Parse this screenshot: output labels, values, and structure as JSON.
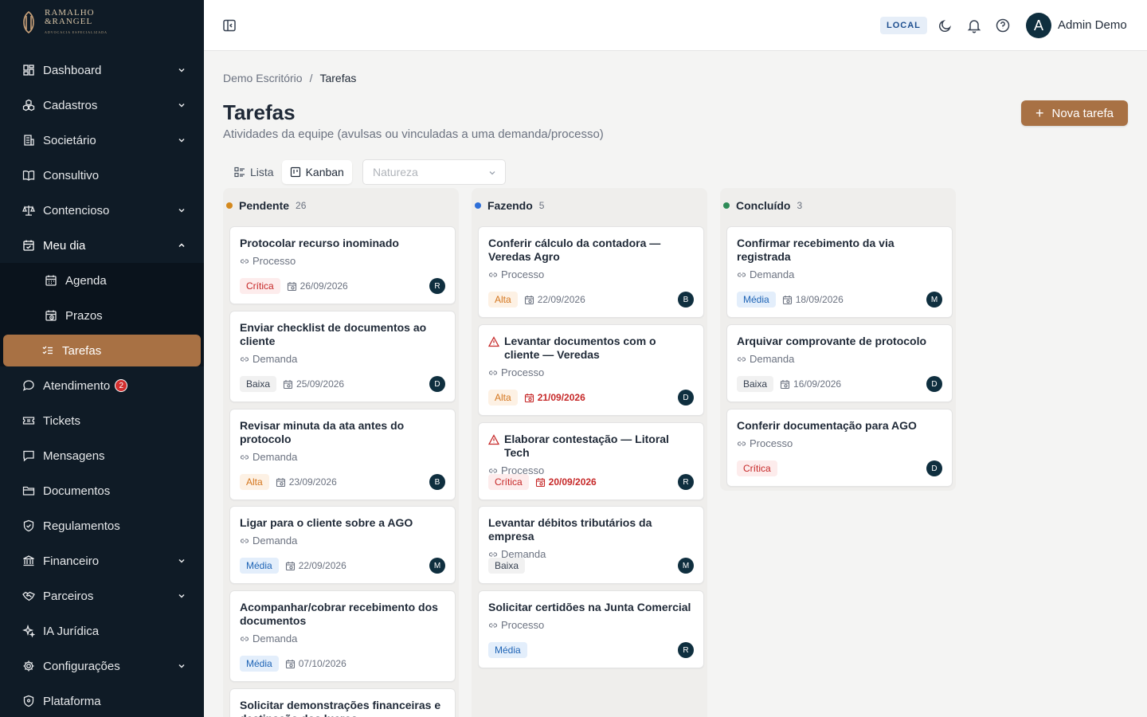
{
  "brand": {
    "line1": "RAMALHO",
    "line2": "&RANGEL",
    "tagline": "ADVOCACIA ESPECIALIZADA"
  },
  "sidebar": {
    "items": [
      {
        "label": "Dashboard",
        "icon": "dashboard-icon",
        "has_chevron": true
      },
      {
        "label": "Cadastros",
        "icon": "cubes-icon",
        "has_chevron": true
      },
      {
        "label": "Societário",
        "icon": "building-icon",
        "has_chevron": true
      },
      {
        "label": "Consultivo",
        "icon": "book-icon",
        "has_chevron": false
      },
      {
        "label": "Contencioso",
        "icon": "scale-icon",
        "has_chevron": true
      },
      {
        "label": "Meu dia",
        "icon": "calendar-check-icon",
        "has_chevron": true,
        "open": true
      },
      {
        "label": "Agenda",
        "icon": "calendar-icon",
        "sub": true
      },
      {
        "label": "Prazos",
        "icon": "calendar-clock-icon",
        "sub": true
      },
      {
        "label": "Tarefas",
        "icon": "checklist-icon",
        "sub": true,
        "active": true
      },
      {
        "label": "Atendimento",
        "icon": "chat-icon",
        "badge": "2"
      },
      {
        "label": "Tickets",
        "icon": "ticket-icon"
      },
      {
        "label": "Mensagens",
        "icon": "message-icon"
      },
      {
        "label": "Documentos",
        "icon": "folder-icon"
      },
      {
        "label": "Regulamentos",
        "icon": "shield-icon"
      },
      {
        "label": "Financeiro",
        "icon": "bank-icon",
        "has_chevron": true
      },
      {
        "label": "Parceiros",
        "icon": "handshake-icon",
        "has_chevron": true
      },
      {
        "label": "IA Jurídica",
        "icon": "sparkles-icon"
      },
      {
        "label": "Configurações",
        "icon": "gear-icon",
        "has_chevron": true
      },
      {
        "label": "Plataforma",
        "icon": "shield-icon"
      }
    ]
  },
  "topbar": {
    "env": "LOCAL",
    "user_initial": "A",
    "user_name": "Admin Demo"
  },
  "breadcrumb": {
    "root": "Demo Escritório",
    "current": "Tarefas"
  },
  "page": {
    "title": "Tarefas",
    "subtitle": "Atividades da equipe (avulsas ou vinculadas a uma demanda/processo)",
    "new_button": "Nova tarefa"
  },
  "view": {
    "list_label": "Lista",
    "kanban_label": "Kanban",
    "filter_placeholder": "Natureza"
  },
  "colors": {
    "accent": "#a87144",
    "sidebar": "#0f1b26",
    "pending": "#d4891e",
    "doing": "#2f6fd8",
    "done": "#2e8b57"
  },
  "columns": [
    {
      "title": "Pendente",
      "count": "26",
      "dot": "#d4891e",
      "cards": [
        {
          "title": "Protocolar recurso inominado",
          "link": "Processo",
          "priority": "Crítica",
          "ptype": "critica",
          "date": "26/09/2026",
          "assignee": "R"
        },
        {
          "title": "Enviar checklist de documentos ao cliente",
          "link": "Demanda",
          "priority": "Baixa",
          "ptype": "baixa",
          "date": "25/09/2026",
          "assignee": "D"
        },
        {
          "title": "Revisar minuta da ata antes do protocolo",
          "link": "Demanda",
          "priority": "Alta",
          "ptype": "alta",
          "date": "23/09/2026",
          "assignee": "B"
        },
        {
          "title": "Ligar para o cliente sobre a AGO",
          "link": "Demanda",
          "priority": "Média",
          "ptype": "media",
          "date": "22/09/2026",
          "assignee": "M"
        },
        {
          "title": "Acompanhar/cobrar recebimento dos documentos",
          "link": "Demanda",
          "priority": "Média",
          "ptype": "media",
          "date": "07/10/2026",
          "assignee": ""
        },
        {
          "title": "Solicitar demonstrações financeiras e destinação dos lucros",
          "link": "",
          "priority": "",
          "ptype": "",
          "date": "",
          "assignee": ""
        }
      ]
    },
    {
      "title": "Fazendo",
      "count": "5",
      "dot": "#2f6fd8",
      "cards": [
        {
          "title": "Conferir cálculo da contadora — Veredas Agro",
          "link": "Processo",
          "priority": "Alta",
          "ptype": "alta",
          "date": "22/09/2026",
          "assignee": "B"
        },
        {
          "title": "Levantar documentos com o cliente — Veredas",
          "link": "Processo",
          "priority": "Alta",
          "ptype": "alta",
          "date": "21/09/2026",
          "assignee": "D",
          "warning": true,
          "overdue": true
        },
        {
          "title": "Elaborar contestação — Litoral Tech",
          "link": "Processo",
          "priority": "Crítica",
          "ptype": "critica",
          "date": "20/09/2026",
          "assignee": "R",
          "warning": true,
          "overdue": true
        },
        {
          "title": "Levantar débitos tributários da empresa",
          "link": "Demanda",
          "priority": "Baixa",
          "ptype": "baixa",
          "date": "",
          "assignee": "M"
        },
        {
          "title": "Solicitar certidões na Junta Comercial",
          "link": "Processo",
          "priority": "Média",
          "ptype": "media",
          "date": "",
          "assignee": "R"
        }
      ]
    },
    {
      "title": "Concluído",
      "count": "3",
      "dot": "#2e8b57",
      "cards": [
        {
          "title": "Confirmar recebimento da via registrada",
          "link": "Demanda",
          "priority": "Média",
          "ptype": "media",
          "date": "18/09/2026",
          "assignee": "M"
        },
        {
          "title": "Arquivar comprovante de protocolo",
          "link": "Demanda",
          "priority": "Baixa",
          "ptype": "baixa",
          "date": "16/09/2026",
          "assignee": "D"
        },
        {
          "title": "Conferir documentação para AGO",
          "link": "Processo",
          "priority": "Crítica",
          "ptype": "critica",
          "date": "",
          "assignee": "D"
        }
      ]
    }
  ]
}
